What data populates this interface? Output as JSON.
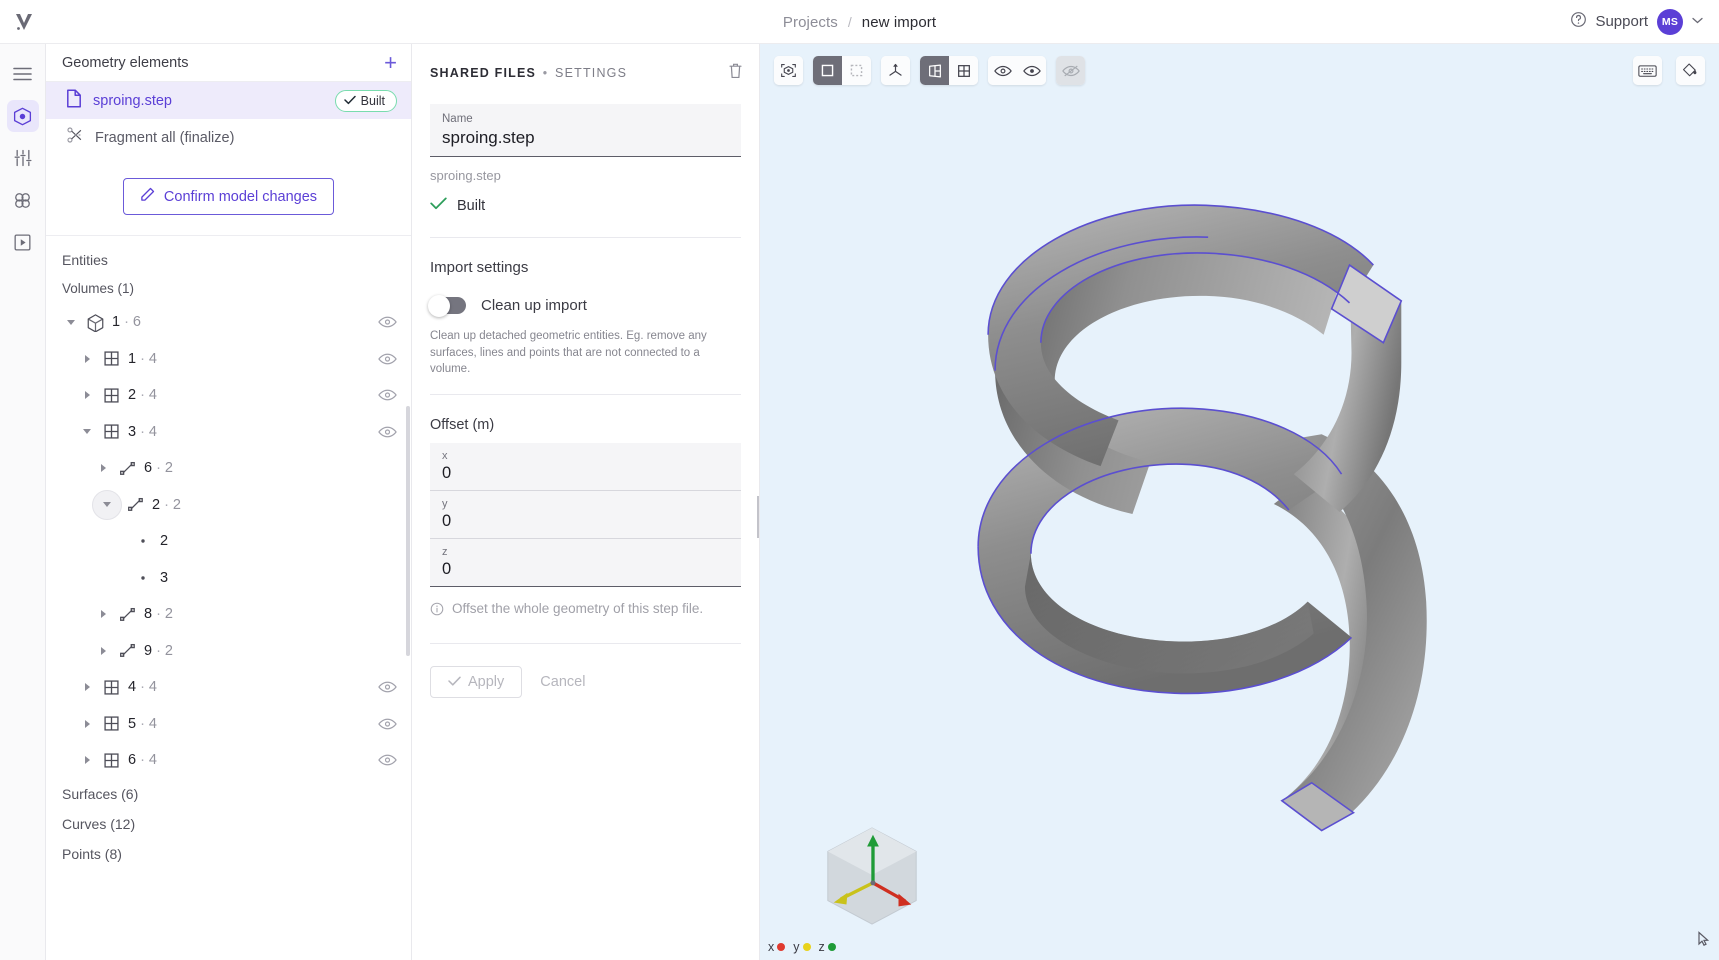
{
  "app": {
    "brand_icon": "app-logo-icon"
  },
  "header": {
    "breadcrumb": {
      "root": "Projects",
      "separator": "/",
      "current": "new import"
    },
    "support_label": "Support",
    "support_icon": "help-circle-icon",
    "avatar_initials": "MS",
    "chevron": "⌄"
  },
  "rail": {
    "items": [
      {
        "name": "menu-icon",
        "label": "Menu",
        "active": false
      },
      {
        "name": "geometry-cube-icon",
        "label": "Geometry",
        "active": true
      },
      {
        "name": "sliders-icon",
        "label": "Simulation setup",
        "active": false
      },
      {
        "name": "mesh-atom-icon",
        "label": "Mesh",
        "active": false
      },
      {
        "name": "run-play-icon",
        "label": "Run",
        "active": false
      }
    ]
  },
  "tree": {
    "header_title": "Geometry elements",
    "add_icon": "plus-icon",
    "rows": [
      {
        "icon": "file-icon",
        "label": "sproing.step",
        "selected": true,
        "badge": "Built",
        "badge_icon": "check-icon"
      },
      {
        "icon": "fragment-icon",
        "label": "Fragment all (finalize)",
        "selected": false,
        "badge": null
      }
    ],
    "confirm_button": {
      "label": "Confirm model changes",
      "icon": "pencil-icon"
    },
    "entities_label": "Entities",
    "volumes_label": "Volumes (1)",
    "nodes": [
      {
        "indent": 0,
        "twisty": "down",
        "icon": "cube-icon",
        "id": "1",
        "count": "6",
        "eye": true,
        "circled": false
      },
      {
        "indent": 1,
        "twisty": "right",
        "icon": "surface-icon",
        "id": "1",
        "count": "4",
        "eye": true,
        "circled": false
      },
      {
        "indent": 1,
        "twisty": "right",
        "icon": "surface-icon",
        "id": "2",
        "count": "4",
        "eye": true,
        "circled": false
      },
      {
        "indent": 1,
        "twisty": "down",
        "icon": "surface-icon",
        "id": "3",
        "count": "4",
        "eye": true,
        "circled": false
      },
      {
        "indent": 2,
        "twisty": "right",
        "icon": "curve-icon",
        "id": "6",
        "count": "2",
        "eye": false,
        "circled": false
      },
      {
        "indent": 2,
        "twisty": "down",
        "icon": "curve-icon",
        "id": "2",
        "count": "2",
        "eye": false,
        "circled": true
      },
      {
        "indent": 3,
        "twisty": "none",
        "icon": "point-icon",
        "id": "2",
        "count": "",
        "eye": false,
        "circled": false
      },
      {
        "indent": 3,
        "twisty": "none",
        "icon": "point-icon",
        "id": "3",
        "count": "",
        "eye": false,
        "circled": false
      },
      {
        "indent": 2,
        "twisty": "right",
        "icon": "curve-icon",
        "id": "8",
        "count": "2",
        "eye": false,
        "circled": false
      },
      {
        "indent": 2,
        "twisty": "right",
        "icon": "curve-icon",
        "id": "9",
        "count": "2",
        "eye": false,
        "circled": false
      },
      {
        "indent": 1,
        "twisty": "right",
        "icon": "surface-icon",
        "id": "4",
        "count": "4",
        "eye": true,
        "circled": false
      },
      {
        "indent": 1,
        "twisty": "right",
        "icon": "surface-icon",
        "id": "5",
        "count": "4",
        "eye": true,
        "circled": false
      },
      {
        "indent": 1,
        "twisty": "right",
        "icon": "surface-icon",
        "id": "6",
        "count": "4",
        "eye": true,
        "circled": false
      }
    ],
    "footer_sections": [
      {
        "label": "Surfaces (6)"
      },
      {
        "label": "Curves (12)"
      },
      {
        "label": "Points (8)"
      }
    ]
  },
  "settings": {
    "title_main": "SHARED FILES",
    "title_sep": "•",
    "title_sub": "SETTINGS",
    "delete_icon": "trash-icon",
    "name_field": {
      "label": "Name",
      "value": "sproing.step"
    },
    "file_name": "sproing.step",
    "status": {
      "icon": "check-icon",
      "text": "Built"
    },
    "import_settings_label": "Import settings",
    "cleanup": {
      "label": "Clean up import",
      "state_on": false,
      "help": "Clean up detached geometric entities. Eg. remove any surfaces, lines and points that are not connected to a volume."
    },
    "offset": {
      "title": "Offset (m)",
      "fields": [
        {
          "label": "x",
          "value": "0"
        },
        {
          "label": "y",
          "value": "0"
        },
        {
          "label": "z",
          "value": "0"
        }
      ],
      "note": "Offset the whole geometry of this step file.",
      "note_icon": "info-icon"
    },
    "apply_button": {
      "label": "Apply",
      "icon": "check-icon",
      "disabled": true
    },
    "cancel_button": {
      "label": "Cancel",
      "disabled": true
    }
  },
  "viewport": {
    "toolbar_left": [
      {
        "name": "fit-view-icon",
        "state": "normal"
      },
      {
        "name": "select-solid-icon",
        "state": "active"
      },
      {
        "name": "select-box-icon",
        "state": "dim"
      },
      {
        "name": "axis-origin-icon",
        "state": "normal"
      },
      {
        "name": "split-view-icon",
        "state": "active"
      },
      {
        "name": "grid-view-icon",
        "state": "normal"
      },
      {
        "name": "eye-visible-icon",
        "state": "normal"
      },
      {
        "name": "eye-hidden-icon",
        "state": "normal"
      },
      {
        "name": "eye-off-icon",
        "state": "disabled"
      }
    ],
    "toolbar_right": [
      {
        "name": "keyboard-shortcuts-icon"
      },
      {
        "name": "color-fill-icon"
      }
    ],
    "axis_legend": [
      {
        "label": "x",
        "color": "#e03a2f"
      },
      {
        "label": "y",
        "color": "#e8d21c"
      },
      {
        "label": "z",
        "color": "#1f9b37"
      }
    ],
    "cursor_icon": "cursor-icon",
    "background": "#e7f2fb",
    "model_edge_color": "#5b4fd0"
  }
}
